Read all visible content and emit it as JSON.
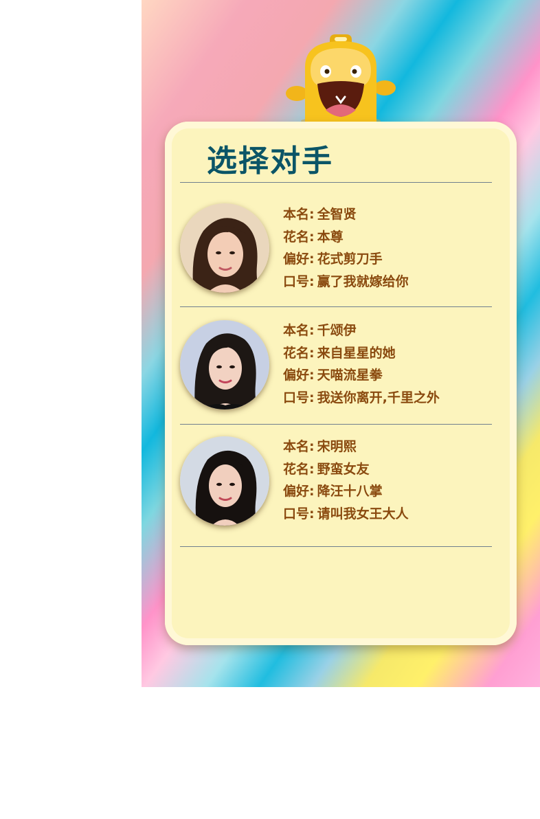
{
  "title": "选择对手",
  "labels": {
    "name": "本名:",
    "alias": "花名:",
    "hobby": "偏好:",
    "motto": "口号:"
  },
  "opponents": [
    {
      "name": "全智贤",
      "alias": "本尊",
      "hobby": "花式剪刀手",
      "motto": "赢了我就嫁给你"
    },
    {
      "name": "千颂伊",
      "alias": "来自星星的她",
      "hobby": "天喵流星拳",
      "motto": "我送你离开,千里之外"
    },
    {
      "name": "宋明熙",
      "alias": "野蛮女友",
      "hobby": "降汪十八掌",
      "motto": "请叫我女王大人"
    }
  ],
  "colors": {
    "title": "#0b5567",
    "text": "#8a4a0f",
    "card": "#fcf4bd",
    "mascot": "#f7c31e"
  },
  "icons": {
    "mascot": "yellow-mascot-icon"
  }
}
